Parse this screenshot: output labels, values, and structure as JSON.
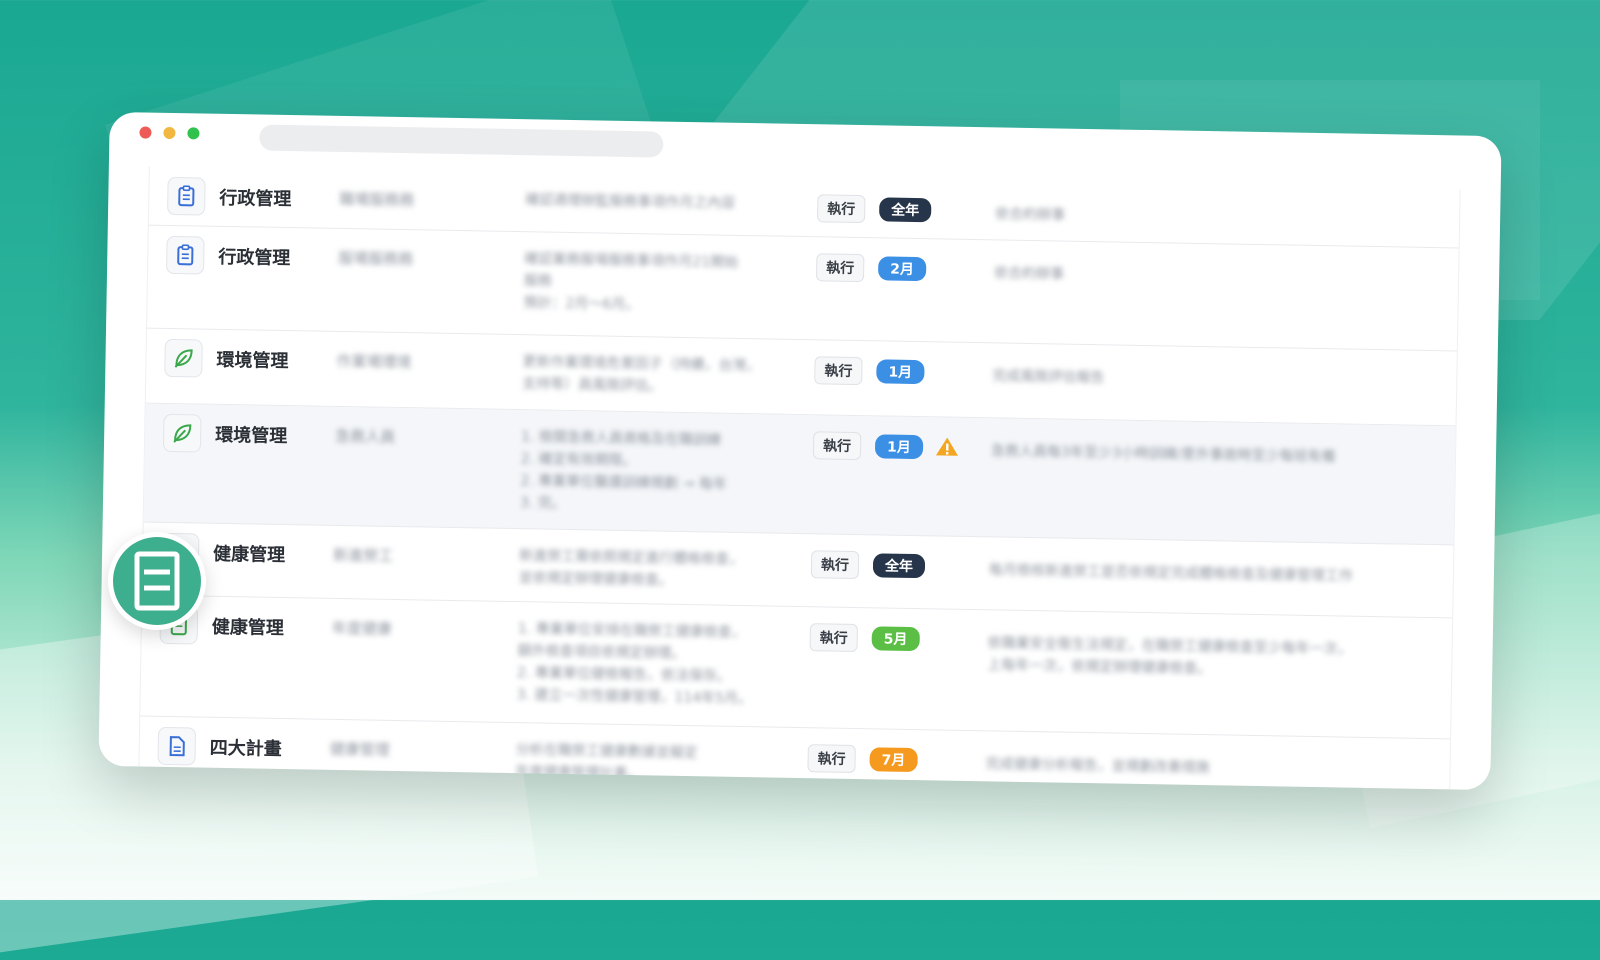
{
  "window": {
    "traffic_lights": [
      "close",
      "minimize",
      "zoom"
    ]
  },
  "colors": {
    "accent": "#2fb49d",
    "month_blue": "#3b8fe4",
    "month_dark": "#26354a",
    "month_green": "#5cbf45",
    "month_orange": "#f59a1f",
    "moon": "#f4a623",
    "warning": "#f4a623"
  },
  "table": {
    "rows": [
      {
        "category": "行政管理",
        "icon": "clipboard-icon",
        "item": "職場服務務",
        "desc": [
          "確認適理辦監服務事項作月之內容"
        ],
        "action": "執行",
        "month": "全年",
        "month_color": "#26354a",
        "status_icon": null,
        "note": "依合約辦事"
      },
      {
        "category": "行政管理",
        "icon": "clipboard-icon",
        "item": "服場服務務",
        "desc": [
          "確認業務服場服務事項作月21開始",
          "服務",
          "預計：2月～6月。"
        ],
        "action": "執行",
        "month": "2月",
        "month_color": "#3b8fe4",
        "status_icon": "moon-icon",
        "note": "依合約辦事"
      },
      {
        "category": "環境管理",
        "icon": "leaf-icon",
        "item": "作業場環境",
        "desc": [
          "更新作業環境危害因子（持續，台灣，",
          "支持等）員風險評估。"
        ],
        "action": "執行",
        "month": "1月",
        "month_color": "#3b8fe4",
        "status_icon": null,
        "note": "完成風險評估報告"
      },
      {
        "category": "環境管理",
        "icon": "leaf-icon",
        "item": "急救人員",
        "desc": [
          "1. 檢閱急救人員資格及在職訓練",
          "2. 確定有效期限。",
          "2. 專業單位醫護訓練規劃 → 每年",
          "3. 完。"
        ],
        "action": "執行",
        "month": "1月",
        "month_color": "#3b8fe4",
        "status_icon": "warning-icon",
        "note": "急救人員每3年至少3小時訓練/意外事故時至少每班有備",
        "highlight": true
      },
      {
        "category": "健康管理",
        "icon": "document-icon",
        "item": "新進勞工",
        "desc": [
          "新進勞工需依照規定進行體格檢查，",
          "並依規定辦理健康檢查。"
        ],
        "action": "執行",
        "month": "全年",
        "month_color": "#26354a",
        "status_icon": null,
        "note": "每月檢核新進勞工是否依規定完成體格檢查及健康管理工作"
      },
      {
        "category": "健康管理",
        "icon": "document-icon",
        "item": "年度健康",
        "desc": [
          "1. 專業單位安排在職勞工健康檢查，",
          "  額外檢查項目依規定辦理。",
          "2. 專業單位健檢報告，依法保存。",
          "3. 建立一次性健康管理，114年5月。"
        ],
        "action": "執行",
        "month": "5月",
        "month_color": "#5cbf45",
        "status_icon": null,
        "note": "依職業安全衛生法規定，在職勞工健康檢查至少每年一次，",
        "note2": "上每年一次，依規定辦理健康檢查。"
      },
      {
        "category": "四大計畫",
        "icon": "file-icon",
        "item": "健康管理",
        "desc": [
          "分析在職勞工健康數據並擬定",
          "年度健康管理計畫。"
        ],
        "action": "執行",
        "month": "7月",
        "month_color": "#f59a1f",
        "status_icon": "moon-icon",
        "note": "完成健康分析報告，並規劃改善措施"
      }
    ]
  },
  "app_badge": {
    "icon": "document-list-icon"
  }
}
